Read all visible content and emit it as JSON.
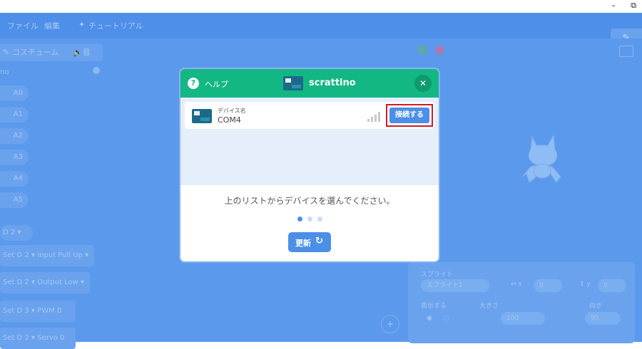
{
  "window": {
    "minimize_glyph": "–",
    "restore_glyph": "⧉"
  },
  "menubar": {
    "file": "ファイル",
    "edit": "編集",
    "tutorials": "チュートリアル",
    "tutorial_icon": "lightbulb-icon",
    "edit_icon": "pencil-icon"
  },
  "tabs": {
    "code": "コスチューム",
    "sounds": "音"
  },
  "palette": {
    "header_fragment": "no",
    "pills": [
      "A0",
      "A1",
      "A2",
      "A3",
      "A4",
      "A5"
    ],
    "blocks": [
      {
        "text": "D  2 ▾"
      },
      {
        "text": "Set D  2 ▾  Input  Pull Up ▾"
      },
      {
        "text": "Set D  2 ▾  Output  Low ▾"
      },
      {
        "text": "Set D  3 ▾  PWM  0"
      },
      {
        "text": "Set D  2 ▾  Servo  0"
      }
    ]
  },
  "sprite_panel": {
    "sprite_label": "スプライト",
    "sprite_name": "スプライト1",
    "x_value": "0",
    "y_value": "0",
    "show_label": "表示する",
    "size_label": "大きさ",
    "size_value": "100",
    "direction_label": "向き",
    "direction_value": "90"
  },
  "modal": {
    "help_label": "ヘルプ",
    "title": "scrattino",
    "device": {
      "label": "デバイス名",
      "value": "COM4"
    },
    "connect_label": "接続する",
    "instruction": "上のリストからデバイスを選んでください。",
    "refresh_label": "更新",
    "active_dot": 1,
    "colors": {
      "header": "#12b784",
      "button": "#4c8fe7",
      "highlight": "#d01b2a"
    }
  }
}
